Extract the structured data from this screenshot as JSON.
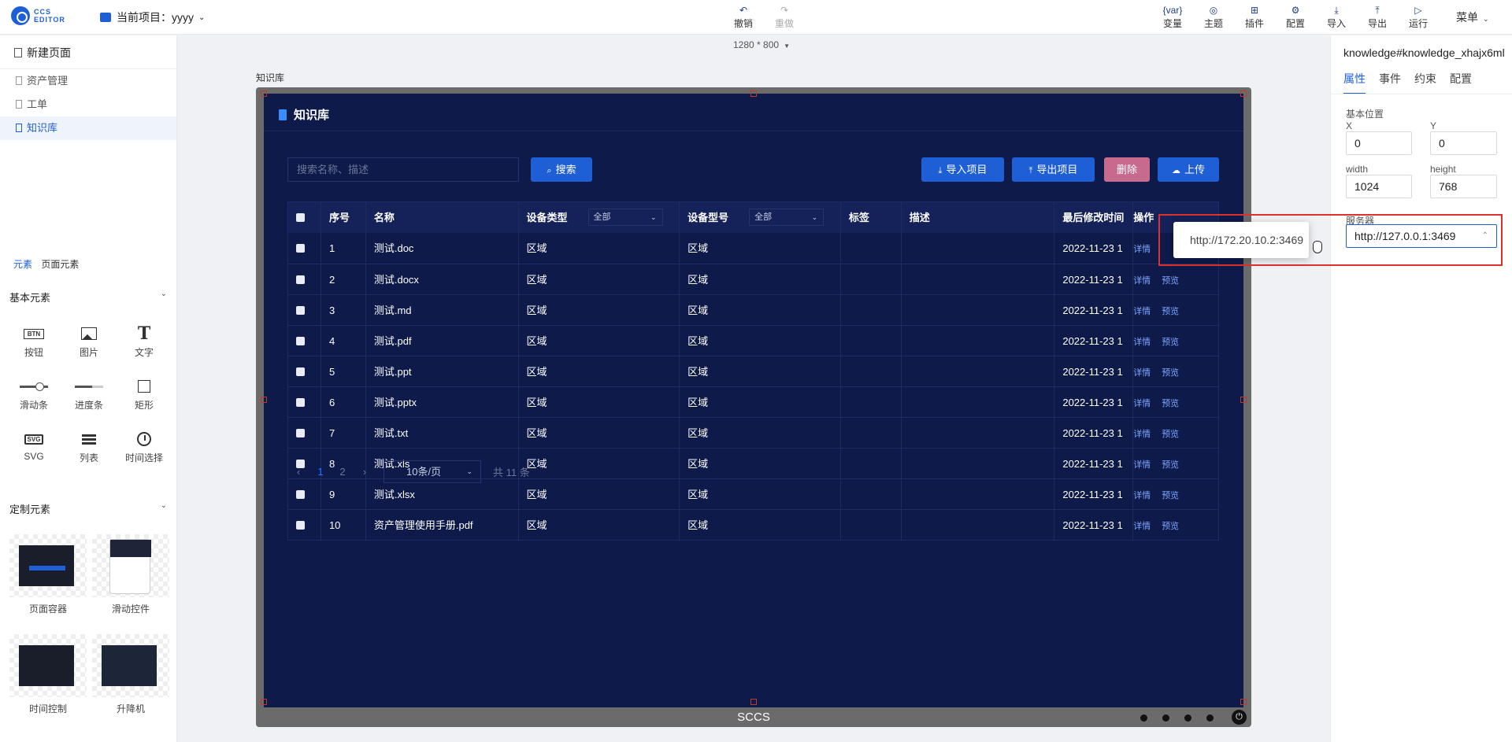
{
  "topbar": {
    "logo_line1": "CCS",
    "logo_line2": "EDITOR",
    "project_label": "当前项目：yyyy",
    "undo": "撤销",
    "redo": "重做",
    "tools": [
      {
        "label": "变量",
        "icon": "{var}"
      },
      {
        "label": "主题",
        "icon": "◎"
      },
      {
        "label": "插件",
        "icon": "⊞"
      },
      {
        "label": "配置",
        "icon": "⚙"
      },
      {
        "label": "导入",
        "icon": "⤓"
      },
      {
        "label": "导出",
        "icon": "⤒"
      },
      {
        "label": "运行",
        "icon": "▷"
      }
    ],
    "menu": "菜单"
  },
  "left": {
    "new_page": "新建页面",
    "pages": [
      "资产管理",
      "工单",
      "知识库"
    ],
    "tabs": [
      "元素",
      "页面元素"
    ],
    "basic_title": "基本元素",
    "basic_items": [
      {
        "label": "按钮",
        "icon": "button-icon",
        "glyph": "BTN"
      },
      {
        "label": "图片",
        "icon": "image-icon"
      },
      {
        "label": "文字",
        "icon": "text-icon",
        "glyph": "T"
      },
      {
        "label": "滑动条",
        "icon": "slider-icon"
      },
      {
        "label": "进度条",
        "icon": "progress-icon"
      },
      {
        "label": "矩形",
        "icon": "rectangle-icon"
      },
      {
        "label": "SVG",
        "icon": "svg-icon",
        "glyph": "SVG"
      },
      {
        "label": "列表",
        "icon": "list-icon"
      },
      {
        "label": "时间选择",
        "icon": "clock-icon"
      }
    ],
    "custom_title": "定制元素",
    "custom_items": [
      "页面容器",
      "滑动控件",
      "时间控制",
      "升降机"
    ]
  },
  "canvas": {
    "size": "1280 * 800",
    "frame_label": "知识库",
    "footer": "SCCS"
  },
  "kb": {
    "title": "知识库",
    "search_placeholder": "搜索名称、描述",
    "search_btn": "搜索",
    "import_btn": "导入项目",
    "export_btn": "导出项目",
    "delete_btn": "删除",
    "upload_btn": "上传",
    "headers": {
      "index": "序号",
      "name": "名称",
      "type": "设备类型",
      "type_filter": "全部",
      "model": "设备型号",
      "model_filter": "全部",
      "tag": "标签",
      "desc": "描述",
      "modified": "最后修改时间",
      "ops": "操作"
    },
    "rows": [
      {
        "idx": "1",
        "name": "测试.doc",
        "type": "区域",
        "model": "区域",
        "time": "2022-11-23 1"
      },
      {
        "idx": "2",
        "name": "测试.docx",
        "type": "区域",
        "model": "区域",
        "time": "2022-11-23 1"
      },
      {
        "idx": "3",
        "name": "测试.md",
        "type": "区域",
        "model": "区域",
        "time": "2022-11-23 1"
      },
      {
        "idx": "4",
        "name": "测试.pdf",
        "type": "区域",
        "model": "区域",
        "time": "2022-11-23 1"
      },
      {
        "idx": "5",
        "name": "测试.ppt",
        "type": "区域",
        "model": "区域",
        "time": "2022-11-23 1"
      },
      {
        "idx": "6",
        "name": "测试.pptx",
        "type": "区域",
        "model": "区域",
        "time": "2022-11-23 1"
      },
      {
        "idx": "7",
        "name": "测试.txt",
        "type": "区域",
        "model": "区域",
        "time": "2022-11-23 1"
      },
      {
        "idx": "8",
        "name": "测试.xls",
        "type": "区域",
        "model": "区域",
        "time": "2022-11-23 1"
      },
      {
        "idx": "9",
        "name": "测试.xlsx",
        "type": "区域",
        "model": "区域",
        "time": "2022-11-23 1"
      },
      {
        "idx": "10",
        "name": "资产管理使用手册.pdf",
        "type": "区域",
        "model": "区域",
        "time": "2022-11-23 1"
      }
    ],
    "op_detail": "详情",
    "op_preview": "预览",
    "pager": {
      "prev": "‹",
      "pages": [
        "1",
        "2"
      ],
      "next": "›",
      "size": "10条/页",
      "total": "共 11 条"
    }
  },
  "right": {
    "title": "knowledge#knowledge_xhajx6ml",
    "tabs": [
      "属性",
      "事件",
      "约束",
      "配置"
    ],
    "basic_pos": "基本位置",
    "x_label": "X",
    "x_value": "0",
    "y_label": "Y",
    "y_value": "0",
    "w_label": "width",
    "w_value": "1024",
    "h_label": "height",
    "h_value": "768",
    "server_label": "服务器",
    "server_value": "http://127.0.0.1:3469",
    "server_option": "http://172.20.10.2:3469"
  },
  "colors": {
    "accent": "#1f5fd6",
    "screen_bg": "#0e1a4a",
    "delete": "#c86a8e",
    "highlight": "#e0302c"
  }
}
